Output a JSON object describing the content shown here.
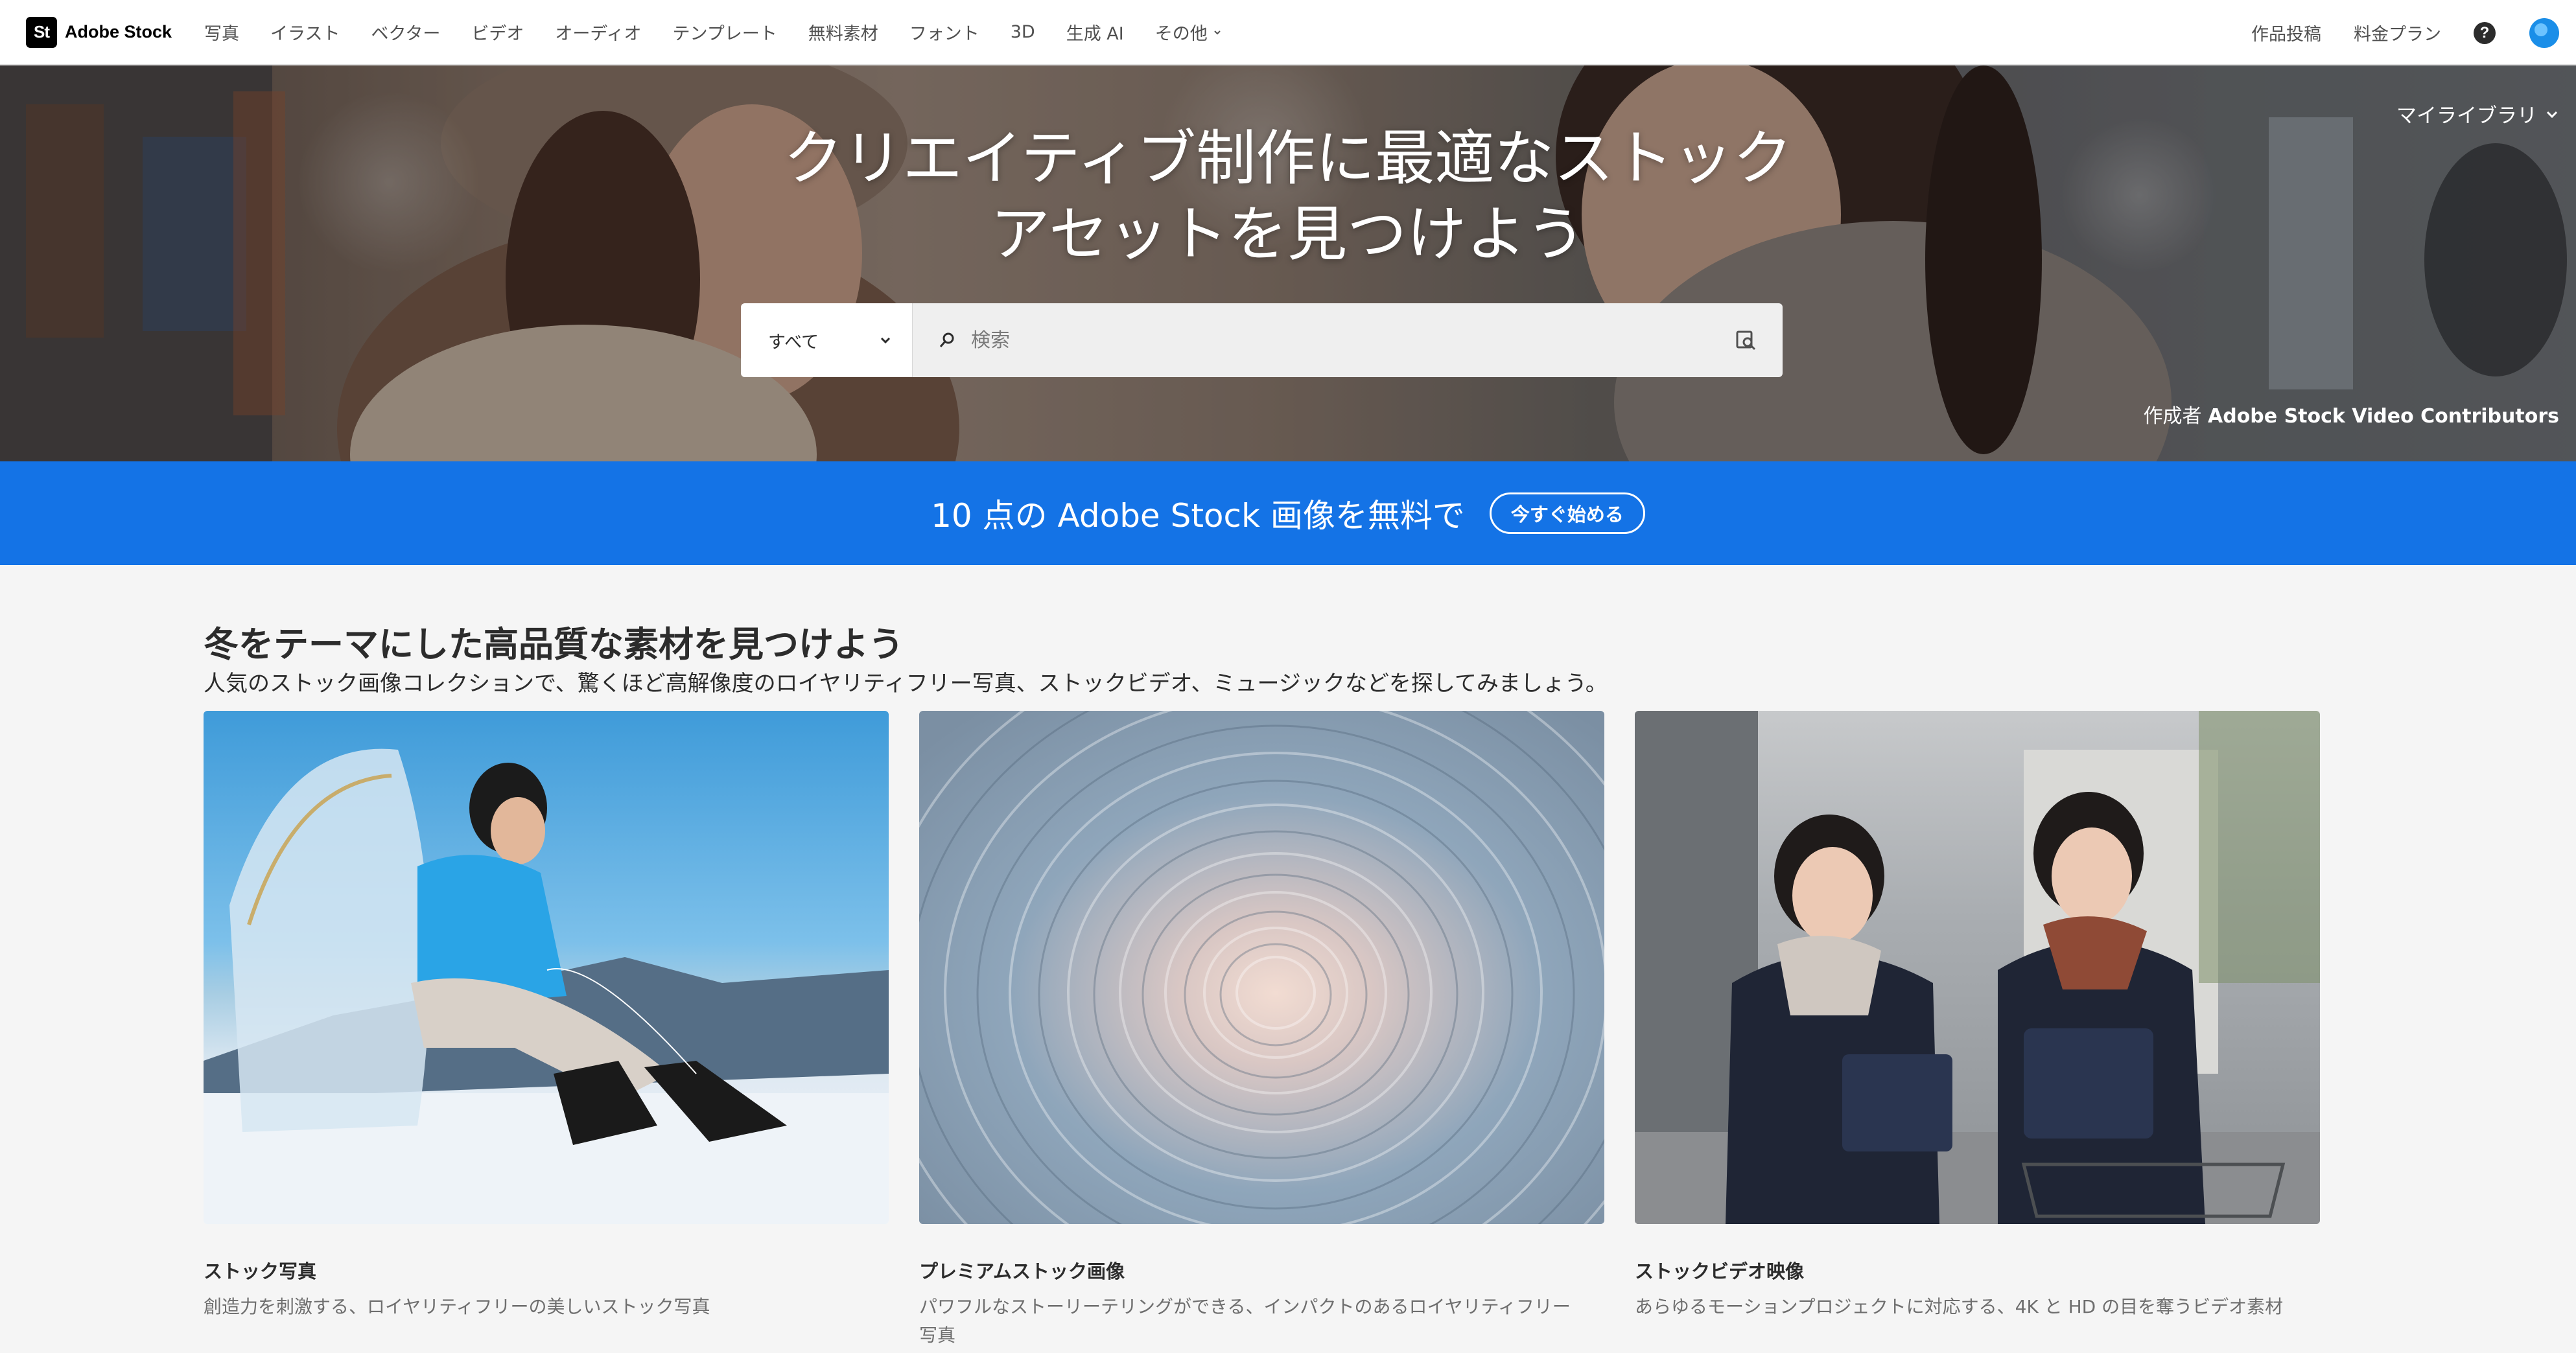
{
  "nav": {
    "logo_mark": "St",
    "logo_text": "Adobe Stock",
    "links": [
      "写真",
      "イラスト",
      "ベクター",
      "ビデオ",
      "オーディオ",
      "テンプレート",
      "無料素材",
      "フォント",
      "3D",
      "生成 AI",
      "その他"
    ],
    "right_links": [
      "作品投稿",
      "料金プラン"
    ],
    "help_symbol": "?"
  },
  "hero": {
    "title_line1": "クリエイティブ制作に最適なストック",
    "title_line2": "アセットを見つけよう",
    "library_label": "マイライブラリ",
    "search": {
      "category": "すべて",
      "placeholder": "検索"
    },
    "credit_prefix": "作成者",
    "credit_name": "Adobe Stock Video Contributors"
  },
  "promo": {
    "text": "10 点の Adobe Stock 画像を無料で",
    "button": "今すぐ始める",
    "color": "#1473e6"
  },
  "section": {
    "title": "冬をテーマにした高品質な素材を見つけよう",
    "subtitle": "人気のストック画像コレクションで、驚くほど高解像度のロイヤリティフリー写真、ストックビデオ、ミュージックなどを探してみましょう。",
    "cards": [
      {
        "title": "ストック写真",
        "desc": "創造力を刺激する、ロイヤリティフリーの美しいストック写真"
      },
      {
        "title": "プレミアムストック画像",
        "desc": "パワフルなストーリーテリングができる、インパクトのあるロイヤリティフリー写真"
      },
      {
        "title": "ストックビデオ映像",
        "desc": "あらゆるモーションプロジェクトに対応する、4K と HD の目を奪うビデオ素材"
      }
    ]
  }
}
